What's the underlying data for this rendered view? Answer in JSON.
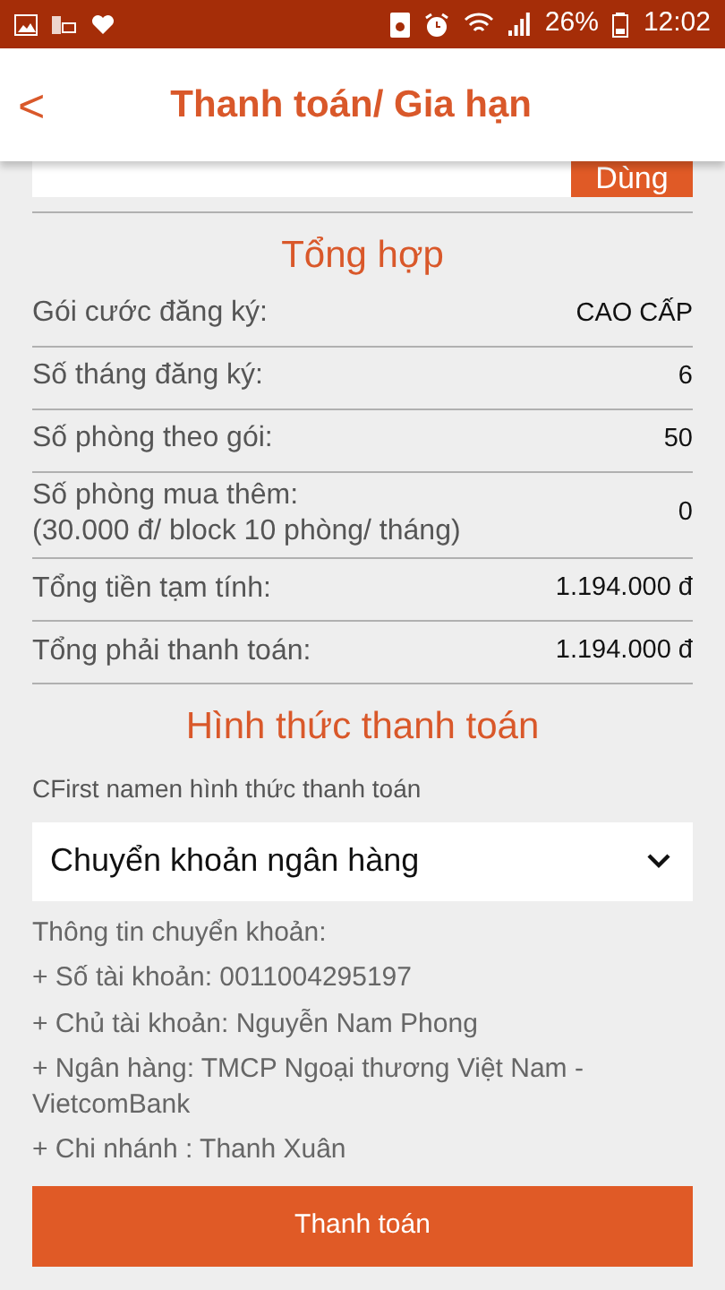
{
  "status_bar": {
    "battery": "26%",
    "time": "12:02"
  },
  "header": {
    "back": "<",
    "title": "Thanh toán/ Gia hạn"
  },
  "promo": {
    "button": "Dùng"
  },
  "summary": {
    "title": "Tổng hợp",
    "rows": [
      {
        "label": "Gói cước đăng ký:",
        "value": "CAO CẤP"
      },
      {
        "label": "Số tháng đăng ký:",
        "value": "6"
      },
      {
        "label": "Số phòng theo gói:",
        "value": "50"
      },
      {
        "label": "Số phòng mua thêm:",
        "note": "(30.000 đ/ block 10 phòng/ tháng)",
        "value": "0"
      },
      {
        "label": "Tổng tiền tạm tính:",
        "value": "1.194.000 đ"
      },
      {
        "label": "Tổng phải thanh toán:",
        "value": "1.194.000 đ"
      }
    ]
  },
  "payment": {
    "title": "Hình thức thanh toán",
    "prompt": "CFirst namen hình thức thanh toán",
    "method": "Chuyển khoản ngân hàng",
    "info": [
      "Thông tin chuyển khoản:",
      "+ Số tài khoản: 0011004295197",
      "+ Chủ tài khoản: Nguyễn Nam Phong",
      "+ Ngân hàng: TMCP Ngoại thương Việt Nam - VietcomBank",
      "+ Chi nhánh : Thanh Xuân"
    ],
    "button": "Thanh toán"
  }
}
